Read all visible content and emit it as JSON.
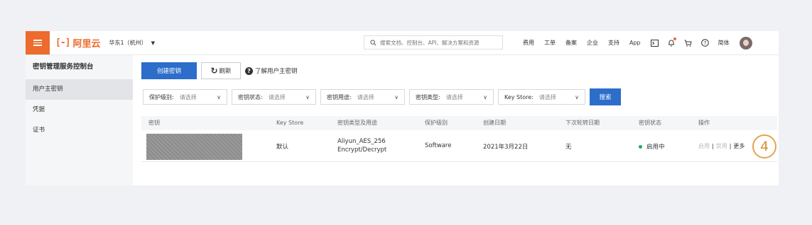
{
  "topbar": {
    "logo_mark": "[-]",
    "logo_text": "阿里云",
    "region": "华东1（杭州）",
    "search_placeholder": "搜索文档、控制台、API、解决方案和资源",
    "links": [
      "费用",
      "工单",
      "备案",
      "企业",
      "支持",
      "App"
    ],
    "lang": "简体"
  },
  "sidebar": {
    "title": "密钥管理服务控制台",
    "items": [
      "用户主密钥",
      "凭据",
      "证书"
    ]
  },
  "toolbar": {
    "create_label": "创建密钥",
    "refresh_label": "刷新",
    "help_label": "了解用户主密钥"
  },
  "filters": [
    {
      "label": "保护级别:",
      "placeholder": "请选择"
    },
    {
      "label": "密钥状态:",
      "placeholder": "请选择"
    },
    {
      "label": "密钥用途:",
      "placeholder": "请选择"
    },
    {
      "label": "密钥类型:",
      "placeholder": "请选择"
    },
    {
      "label": "Key Store:",
      "placeholder": "请选择"
    }
  ],
  "search_label": "搜索",
  "table": {
    "columns": [
      "密钥",
      "Key Store",
      "密钥类型及用途",
      "保护级别",
      "创建日期",
      "下次轮转日期",
      "密钥状态",
      "操作"
    ],
    "rows": [
      {
        "key_store": "默认",
        "type_line1": "Aliyun_AES_256",
        "type_line2": "Encrypt/Decrypt",
        "protection": "Software",
        "created": "2021年3月22日",
        "next_rotation": "无",
        "status": "启用中",
        "action_enable": "启用",
        "action_disable": "禁用",
        "action_more": "更多"
      }
    ]
  },
  "callout": "4",
  "colors": {
    "brand": "#ec6b2d",
    "primary": "#2c6ec9",
    "status_green": "#22ab5c",
    "callout": "#e3a44d"
  }
}
